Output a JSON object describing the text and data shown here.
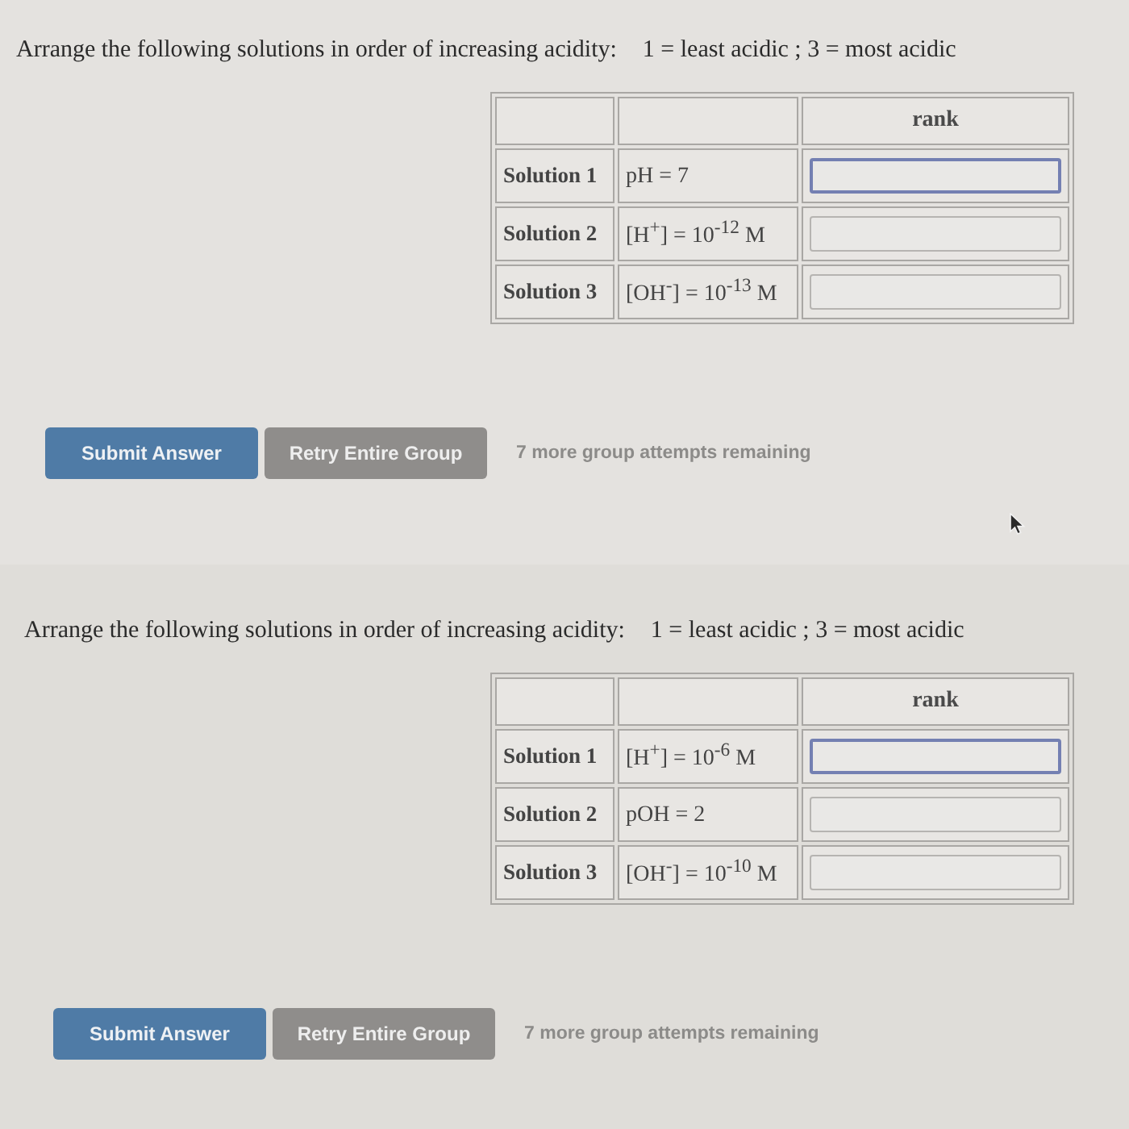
{
  "questions": [
    {
      "prompt": "Arrange the following solutions in order of increasing acidity:",
      "legend": "1 = least acidic ;  3 = most acidic",
      "rank_header": "rank",
      "rows": [
        {
          "label": "Solution 1",
          "condition": "pH = 7",
          "focused": true
        },
        {
          "label": "Solution 2",
          "condition": "[H$^{+}$] = 10$^{-12}$ M",
          "focused": false
        },
        {
          "label": "Solution 3",
          "condition": "[OH$^{-}$] = 10$^{-13}$ M",
          "focused": false
        }
      ],
      "buttons": [
        {
          "label": "Submit Answer",
          "kind": "primary"
        },
        {
          "label": "Retry Entire Group",
          "kind": "secondary"
        }
      ],
      "attempts_note": "7 more group attempts remaining",
      "pointer_visible": true
    },
    {
      "prompt": "Arrange the following solutions in order of increasing acidity:",
      "legend": "1 = least acidic ;  3 = most acidic",
      "rank_header": "rank",
      "rows": [
        {
          "label": "Solution 1",
          "condition": "[H$^{+}$] = 10$^{-6}$ M",
          "focused": true
        },
        {
          "label": "Solution 2",
          "condition": "pOH = 2",
          "focused": false
        },
        {
          "label": "Solution 3",
          "condition": "[OH$^{-}$] = 10$^{-10}$ M",
          "focused": false
        }
      ],
      "buttons": [
        {
          "label": "Submit Answer",
          "kind": "primary"
        },
        {
          "label": "Retry Entire Group",
          "kind": "secondary"
        }
      ],
      "attempts_note": "7 more group attempts remaining"
    }
  ]
}
